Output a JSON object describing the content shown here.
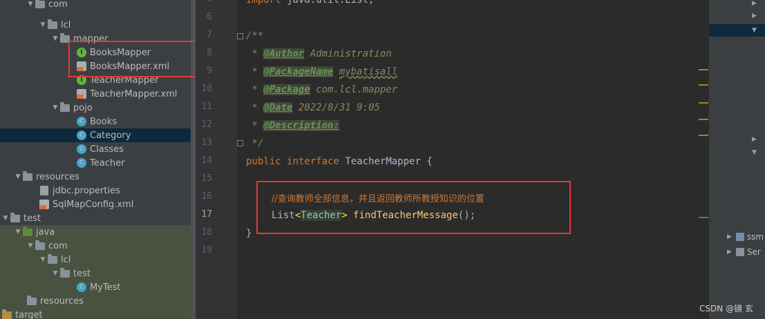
{
  "project_tree": {
    "items": [
      {
        "label": "com"
      },
      {
        "label": "lcl"
      },
      {
        "label": "mapper"
      },
      {
        "label": "BooksMapper"
      },
      {
        "label": "BooksMapper.xml"
      },
      {
        "label": "TeacherMapper"
      },
      {
        "label": "TeacherMapper.xml"
      },
      {
        "label": "pojo"
      },
      {
        "label": "Books"
      },
      {
        "label": "Category"
      },
      {
        "label": "Classes"
      },
      {
        "label": "Teacher"
      },
      {
        "label": "resources"
      },
      {
        "label": "jdbc.properties"
      },
      {
        "label": "SqlMapConfig.xml"
      },
      {
        "label": "test"
      },
      {
        "label": "java"
      },
      {
        "label": "com"
      },
      {
        "label": "lcl"
      },
      {
        "label": "test"
      },
      {
        "label": "MyTest"
      },
      {
        "label": "resources"
      },
      {
        "label": "target"
      }
    ],
    "selected": "Category"
  },
  "editor": {
    "line_numbers": [
      "5",
      "6",
      "7",
      "8",
      "9",
      "10",
      "11",
      "12",
      "13",
      "14",
      "15",
      "16",
      "17",
      "18",
      "19"
    ],
    "active_line": "17",
    "code": {
      "l5_kw": "import",
      "l5_rest": " java.util.List;",
      "l7": "/**",
      "l8_prefix": " * ",
      "l8_tag": "@Author",
      "l8_val": " Administration",
      "l9_tag": "@PackageName",
      "l9_val": "mybatisall",
      "l10_tag": "@Package",
      "l10_val": " com.lcl.mapper",
      "l11_tag": "@Date",
      "l11_val": " 2022/8/31 9:05",
      "l12_tag": "@Description:",
      "l13": " */",
      "l14_kw1": "public",
      "l14_kw2": "interface",
      "l14_name": "TeacherMapper",
      "l14_brace": " {",
      "l16_comment": "//查询教师全部信息，并且返回教师所教授知识的位置",
      "l17_type": "List",
      "l17_lt": "<",
      "l17_param": "Teacher",
      "l17_gt": ">",
      "l17_method": "findTeacherMessage",
      "l17_end": "();",
      "l18": "}"
    }
  },
  "right_panel": {
    "items": [
      {
        "label": "ssm"
      },
      {
        "label": "Ser"
      }
    ]
  },
  "watermark": "CSDN @镜 玄",
  "colors": {
    "highlight_box": "#e53935",
    "selection": "#0d293e",
    "keyword": "#cc7832",
    "doc_comment": "#629755",
    "method": "#ffc66d"
  }
}
